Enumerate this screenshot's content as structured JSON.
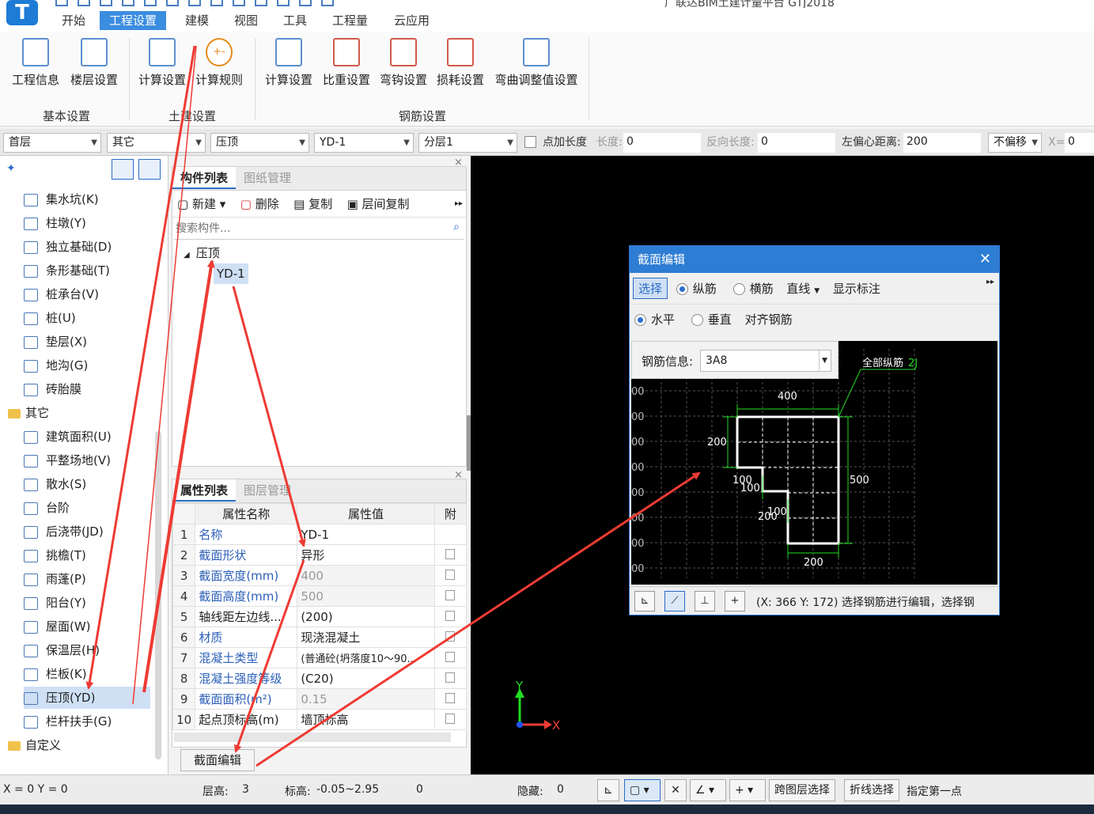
{
  "app": {
    "logo": "T",
    "title": "广联达BIM土建计量平台 GTJ2018"
  },
  "tabs": [
    {
      "label": "开始"
    },
    {
      "label": "工程设置"
    },
    {
      "label": "建模"
    },
    {
      "label": "视图"
    },
    {
      "label": "工具"
    },
    {
      "label": "工程量"
    },
    {
      "label": "云应用"
    }
  ],
  "ribbon": {
    "buttons": [
      {
        "label": "工程信息"
      },
      {
        "label": "楼层设置"
      },
      {
        "label": "计算设置"
      },
      {
        "label": "计算规则"
      },
      {
        "label": "计算设置"
      },
      {
        "label": "比重设置"
      },
      {
        "label": "弯钩设置"
      },
      {
        "label": "损耗设置"
      },
      {
        "label": "弯曲调整值设置"
      }
    ],
    "groups": [
      {
        "label": "基本设置"
      },
      {
        "label": "土建设置"
      },
      {
        "label": "钢筋设置"
      }
    ],
    "calc_rule_icon": "+-"
  },
  "toolbar": {
    "floor": "首层",
    "category": "其它",
    "type": "压顶",
    "component": "YD-1",
    "layer": "分层1",
    "add_length_label": "点加长度",
    "length_label": "长度:",
    "length_value": "0",
    "reverse_length_label": "反向长度:",
    "reverse_length_value": "0",
    "left_offset_label": "左偏心距离:",
    "left_offset_value": "200",
    "offset_mode": "不偏移",
    "x_label": "X=",
    "x_value": "0"
  },
  "left_panel": {
    "items": [
      {
        "label": "集水坑(K)"
      },
      {
        "label": "柱墩(Y)"
      },
      {
        "label": "独立基础(D)"
      },
      {
        "label": "条形基础(T)"
      },
      {
        "label": "桩承台(V)"
      },
      {
        "label": "桩(U)"
      },
      {
        "label": "垫层(X)"
      },
      {
        "label": "地沟(G)"
      },
      {
        "label": "砖胎膜"
      }
    ],
    "folder_other": "其它",
    "other_items": [
      {
        "label": "建筑面积(U)"
      },
      {
        "label": "平整场地(V)"
      },
      {
        "label": "散水(S)"
      },
      {
        "label": "台阶"
      },
      {
        "label": "后浇带(JD)"
      },
      {
        "label": "挑檐(T)"
      },
      {
        "label": "雨蓬(P)"
      },
      {
        "label": "阳台(Y)"
      },
      {
        "label": "屋面(W)"
      },
      {
        "label": "保温层(H)"
      },
      {
        "label": "栏板(K)"
      },
      {
        "label": "压顶(YD)"
      },
      {
        "label": "栏杆扶手(G)"
      }
    ],
    "folder_custom": "自定义"
  },
  "component_panel": {
    "tab_active": "构件列表",
    "tab_inactive": "图纸管理",
    "new": "新建",
    "delete": "删除",
    "copy": "复制",
    "floor_copy": "层间复制",
    "search_placeholder": "搜索构件...",
    "tree_root": "压顶",
    "tree_child": "YD-1"
  },
  "property_panel": {
    "tab_active": "属性列表",
    "tab_inactive": "图层管理",
    "col_name": "属性名称",
    "col_value": "属性值",
    "col_attach": "附",
    "rows": [
      {
        "num": "1",
        "name": "名称",
        "value": "YD-1"
      },
      {
        "num": "2",
        "name": "截面形状",
        "value": "异形"
      },
      {
        "num": "3",
        "name": "截面宽度(mm)",
        "value": "400"
      },
      {
        "num": "4",
        "name": "截面高度(mm)",
        "value": "500"
      },
      {
        "num": "5",
        "name": "轴线距左边线...",
        "value": "(200)"
      },
      {
        "num": "6",
        "name": "材质",
        "value": "现浇混凝土"
      },
      {
        "num": "7",
        "name": "混凝土类型",
        "value": "(普通砼(坍落度10～90..."
      },
      {
        "num": "8",
        "name": "混凝土强度等级",
        "value": "(C20)"
      },
      {
        "num": "9",
        "name": "截面面积(m²)",
        "value": "0.15"
      },
      {
        "num": "10",
        "name": "起点顶标高(m)",
        "value": "墙顶标高"
      }
    ],
    "section_edit_button": "截面编辑"
  },
  "dialog": {
    "title": "截面编辑",
    "select": "选择",
    "longitudinal": "纵筋",
    "transverse": "横筋",
    "line_mode": "直线",
    "show_dims": "显示标注",
    "horizontal": "水平",
    "vertical": "垂直",
    "align": "对齐钢筋",
    "rebar_label": "钢筋信息:",
    "rebar_value": "3A8",
    "all_long_label": "全部纵筋",
    "all_long_suffix": "2J",
    "dims": {
      "top": "400",
      "left": "200",
      "right": "500",
      "step1": "100",
      "step2": "100",
      "step3": "200",
      "step4": "100",
      "bottom": "200"
    },
    "left_ticks": [
      "00",
      "00",
      "00",
      "00",
      "00",
      "00",
      "00",
      "00"
    ],
    "status": "(X: 366 Y: 172) 选择钢筋进行编辑，选择钢"
  },
  "axis": {
    "x": "X",
    "y": "Y"
  },
  "status_bar": {
    "coords": "X = 0 Y = 0",
    "floor_height_label": "层高:",
    "floor_height": "3",
    "elevation_label": "标高:",
    "elevation": "-0.05~2.95",
    "zero": "0",
    "hidden_label": "隐藏:",
    "hidden": "0",
    "cross_layer": "跨图层选择",
    "polyline": "折线选择",
    "specify_point": "指定第一点"
  },
  "colors": {
    "accent": "#2e7dd4",
    "arrow": "#ee3b34",
    "dim_green": "#22dd22",
    "canvas": "#000000"
  }
}
